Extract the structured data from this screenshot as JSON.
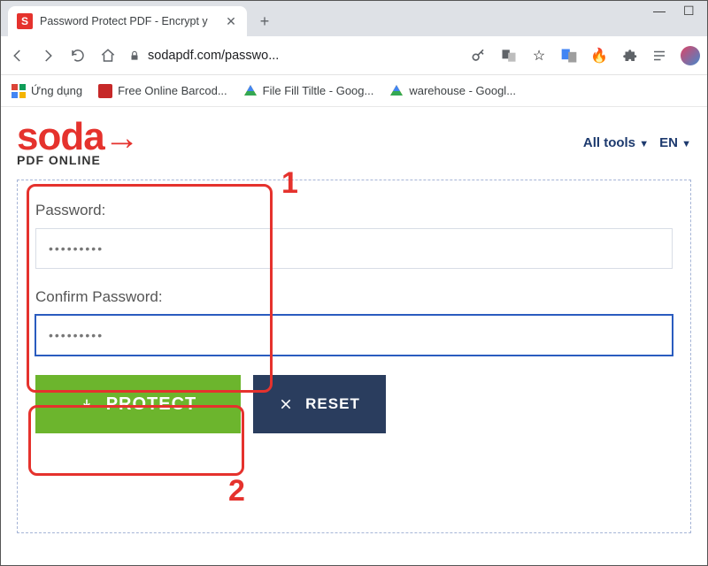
{
  "browser": {
    "tab_title": "Password Protect PDF - Encrypt y",
    "favicon_letter": "S",
    "url_display": "sodapdf.com/passwo...",
    "bookmarks": {
      "apps_label": "Ứng dụng",
      "items": [
        {
          "label": "Free Online Barcod...",
          "color": "#c62828"
        },
        {
          "label": "File Fill Tiltle - Goog...",
          "color": "#fbbc04"
        },
        {
          "label": "warehouse - Googl...",
          "color": "#fbbc04"
        }
      ]
    }
  },
  "header": {
    "logo_main": "soda",
    "logo_sub": "PDF ONLINE",
    "all_tools": "All tools",
    "lang": "EN"
  },
  "form": {
    "password_label": "Password:",
    "password_value": "•••••••••",
    "confirm_label": "Confirm Password:",
    "confirm_value": "•••••••••",
    "protect_btn": "PROTECT",
    "reset_btn": "RESET"
  },
  "annotations": {
    "num1": "1",
    "num2": "2"
  }
}
